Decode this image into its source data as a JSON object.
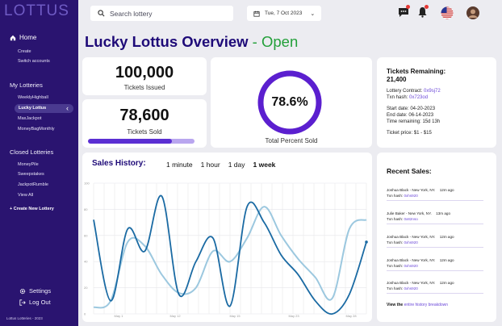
{
  "app": {
    "logo": "LOTTUS",
    "copyright": "Lottus Lotteries - 2023"
  },
  "nav": {
    "home": "Home",
    "home_items": [
      "Create",
      "Switch accounts"
    ],
    "my_lotteries_title": "My Lotteries",
    "my_lotteries": [
      "WeeklyHighball",
      "Lucky Lottus",
      "MaxJackpot",
      "MoneyBagMonthly"
    ],
    "active_lottery": "Lucky Lottus",
    "closed_lotteries_title": "Closed Lotteries",
    "closed_lotteries": [
      "MoneyPile",
      "Sweepstakes",
      "JackpotRumble",
      "View All"
    ],
    "create_new": "+ Create New Lottery",
    "settings": "Settings",
    "logout": "Log Out"
  },
  "topbar": {
    "search_placeholder": "Search lottery",
    "date": "Tue, 7 Oct 2023"
  },
  "page": {
    "title": "Lucky Lottus Overview",
    "separator": " - ",
    "status": "Open"
  },
  "stats": {
    "tickets_issued": "100,000",
    "tickets_issued_label": "Tickets Issued",
    "tickets_sold": "78,600",
    "tickets_sold_label": "Tickets Sold",
    "percent_sold": "78.6%",
    "percent_sold_value": 0.786,
    "percent_label": "Total Percent Sold"
  },
  "tickets": {
    "title_line1": "Tickets Remaining:",
    "title_line2": "21,400",
    "contract_label": "Lottery Contract: ",
    "contract": "0x9sj72",
    "txn_label": "Txn hash: ",
    "txn": "0x723od",
    "start": "Start date: 04-20-2023",
    "end": "End date: 06-14-2023",
    "remaining": "Time remaining: 15d 13h",
    "price": "Ticket price: $1 - $15"
  },
  "sales_history": {
    "title": "Sales History:",
    "ranges": [
      "1 minute",
      "1 hour",
      "1 day",
      "1 week"
    ],
    "active_range": "1 week"
  },
  "chart_data": {
    "type": "line",
    "ylim": [
      0,
      100
    ],
    "yticks": [
      "100",
      "80",
      "60",
      "40",
      "20",
      "0"
    ],
    "xticks": [
      "May 1",
      "May 12",
      "May 15",
      "May 23",
      "May 28"
    ],
    "series": [
      {
        "color": "#1a6aa3",
        "values": [
          72,
          10,
          65,
          48,
          90,
          15,
          40,
          58,
          6,
          82,
          70,
          45,
          30,
          10,
          0,
          15,
          55
        ]
      },
      {
        "color": "#9cc8df",
        "values": [
          5,
          10,
          55,
          52,
          30,
          16,
          20,
          48,
          40,
          58,
          82,
          60,
          42,
          28,
          12,
          65,
          72
        ]
      }
    ]
  },
  "recent_sales": {
    "title": "Recent Sales:",
    "items": [
      {
        "who": "Joshua Black - New York, NY.",
        "ago": "12m ago",
        "txn_label": "Txn hash: ",
        "txn": "0xhs920"
      },
      {
        "who": "Julie Baker - New York, NY.",
        "ago": "13m ago",
        "txn_label": "Txn hash: ",
        "txn": "0x82nso"
      },
      {
        "who": "Joshua Black - New York, NY.",
        "ago": "12m ago",
        "txn_label": "Txn hash: ",
        "txn": "0xhs920"
      },
      {
        "who": "Joshua Black - New York, NY.",
        "ago": "12m ago",
        "txn_label": "Txn hash: ",
        "txn": "0xhs920"
      },
      {
        "who": "Joshua Black - New York, NY.",
        "ago": "12m ago",
        "txn_label": "Txn hash: ",
        "txn": "0xhs920"
      }
    ],
    "view_all_prefix": "View the ",
    "view_all_link": "entire history breakdown"
  },
  "colors": {
    "sidebar": "#2a1470",
    "accent": "#6b48d8",
    "title": "#1e0a78",
    "open": "#23a03a"
  }
}
